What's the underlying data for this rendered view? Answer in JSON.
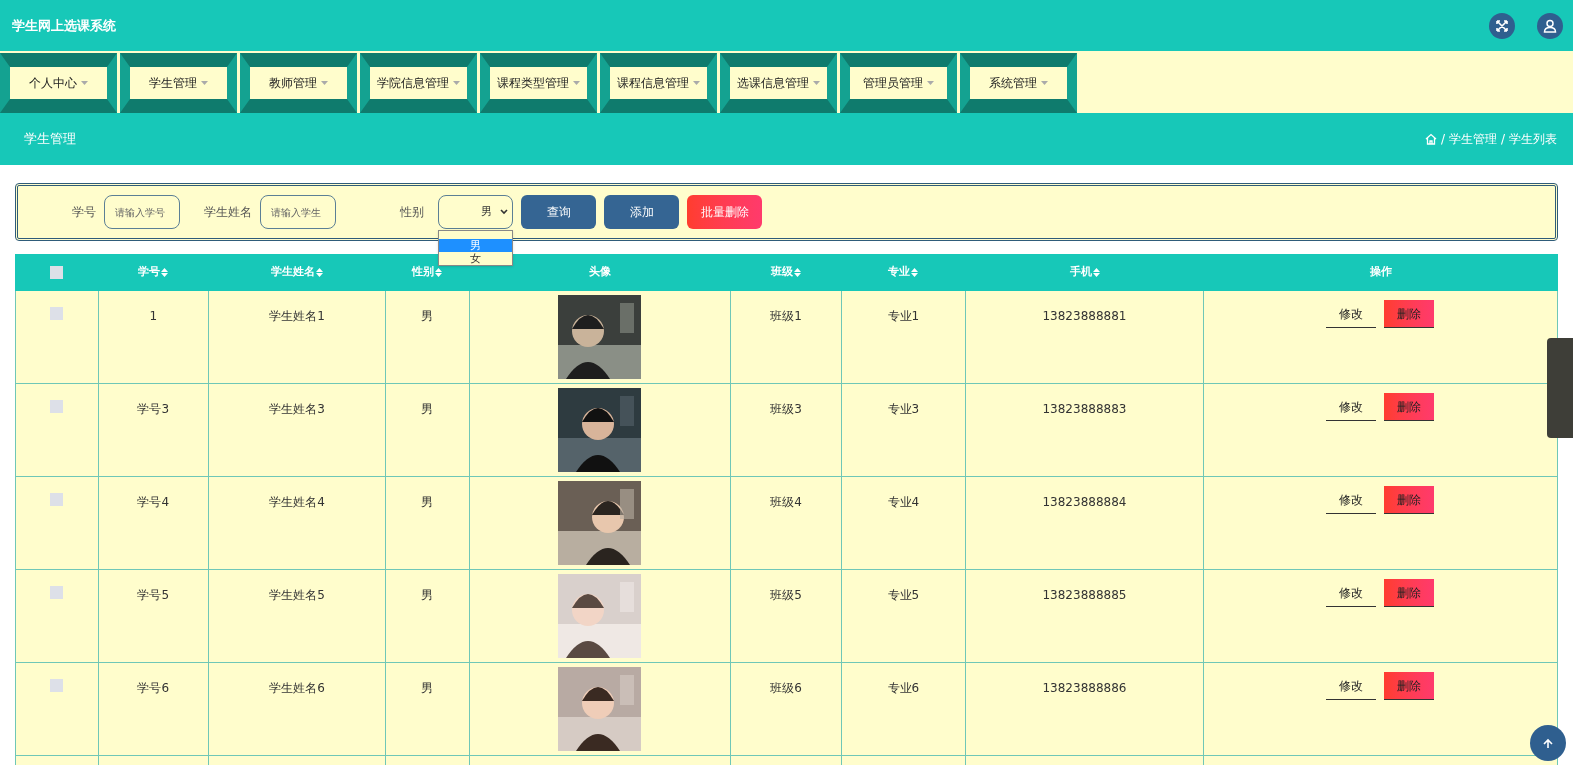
{
  "app_title": "学生网上选课系统",
  "menu": [
    {
      "label": "个人中心"
    },
    {
      "label": "学生管理"
    },
    {
      "label": "教师管理"
    },
    {
      "label": "学院信息管理"
    },
    {
      "label": "课程类型管理"
    },
    {
      "label": "课程信息管理"
    },
    {
      "label": "选课信息管理"
    },
    {
      "label": "管理员管理"
    },
    {
      "label": "系统管理"
    }
  ],
  "section_title": "学生管理",
  "breadcrumb": {
    "separator": "/",
    "items": [
      "学生管理",
      "学生列表"
    ]
  },
  "search": {
    "fields": [
      {
        "label": "学号",
        "placeholder": "请输入学号"
      },
      {
        "label": "学生姓名",
        "placeholder": "请输入学生"
      }
    ],
    "gender": {
      "label": "性别",
      "value": "男",
      "options": [
        {
          "label": "男",
          "selected": true
        },
        {
          "label": "女",
          "selected": false
        }
      ]
    },
    "buttons": [
      {
        "label": "查询",
        "kind": "primary"
      },
      {
        "label": "添加",
        "kind": "primary"
      },
      {
        "label": "批量删除",
        "kind": "danger"
      }
    ]
  },
  "table": {
    "header_checkbox": {
      "checked": false
    },
    "columns": [
      {
        "label": "学号",
        "sortable": true
      },
      {
        "label": "学生姓名",
        "sortable": true
      },
      {
        "label": "性别",
        "sortable": true
      },
      {
        "label": "头像",
        "sortable": false
      },
      {
        "label": "班级",
        "sortable": true
      },
      {
        "label": "专业",
        "sortable": true
      },
      {
        "label": "手机",
        "sortable": true
      },
      {
        "label": "操作",
        "sortable": false
      }
    ],
    "rows": [
      {
        "checked": false,
        "id": "1",
        "name": "学生姓名1",
        "gender": "男",
        "class": "班级1",
        "major": "专业1",
        "phone": "13823888881",
        "actions": [
          "修改",
          "删除"
        ]
      },
      {
        "checked": false,
        "id": "学号3",
        "name": "学生姓名3",
        "gender": "男",
        "class": "班级3",
        "major": "专业3",
        "phone": "13823888883",
        "actions": [
          "修改",
          "删除"
        ]
      },
      {
        "checked": false,
        "id": "学号4",
        "name": "学生姓名4",
        "gender": "男",
        "class": "班级4",
        "major": "专业4",
        "phone": "13823888884",
        "actions": [
          "修改",
          "删除"
        ]
      },
      {
        "checked": false,
        "id": "学号5",
        "name": "学生姓名5",
        "gender": "男",
        "class": "班级5",
        "major": "专业5",
        "phone": "13823888885",
        "actions": [
          "修改",
          "删除"
        ]
      },
      {
        "checked": false,
        "id": "学号6",
        "name": "学生姓名6",
        "gender": "男",
        "class": "班级6",
        "major": "专业6",
        "phone": "13823888886",
        "actions": [
          "修改",
          "删除"
        ]
      }
    ]
  }
}
